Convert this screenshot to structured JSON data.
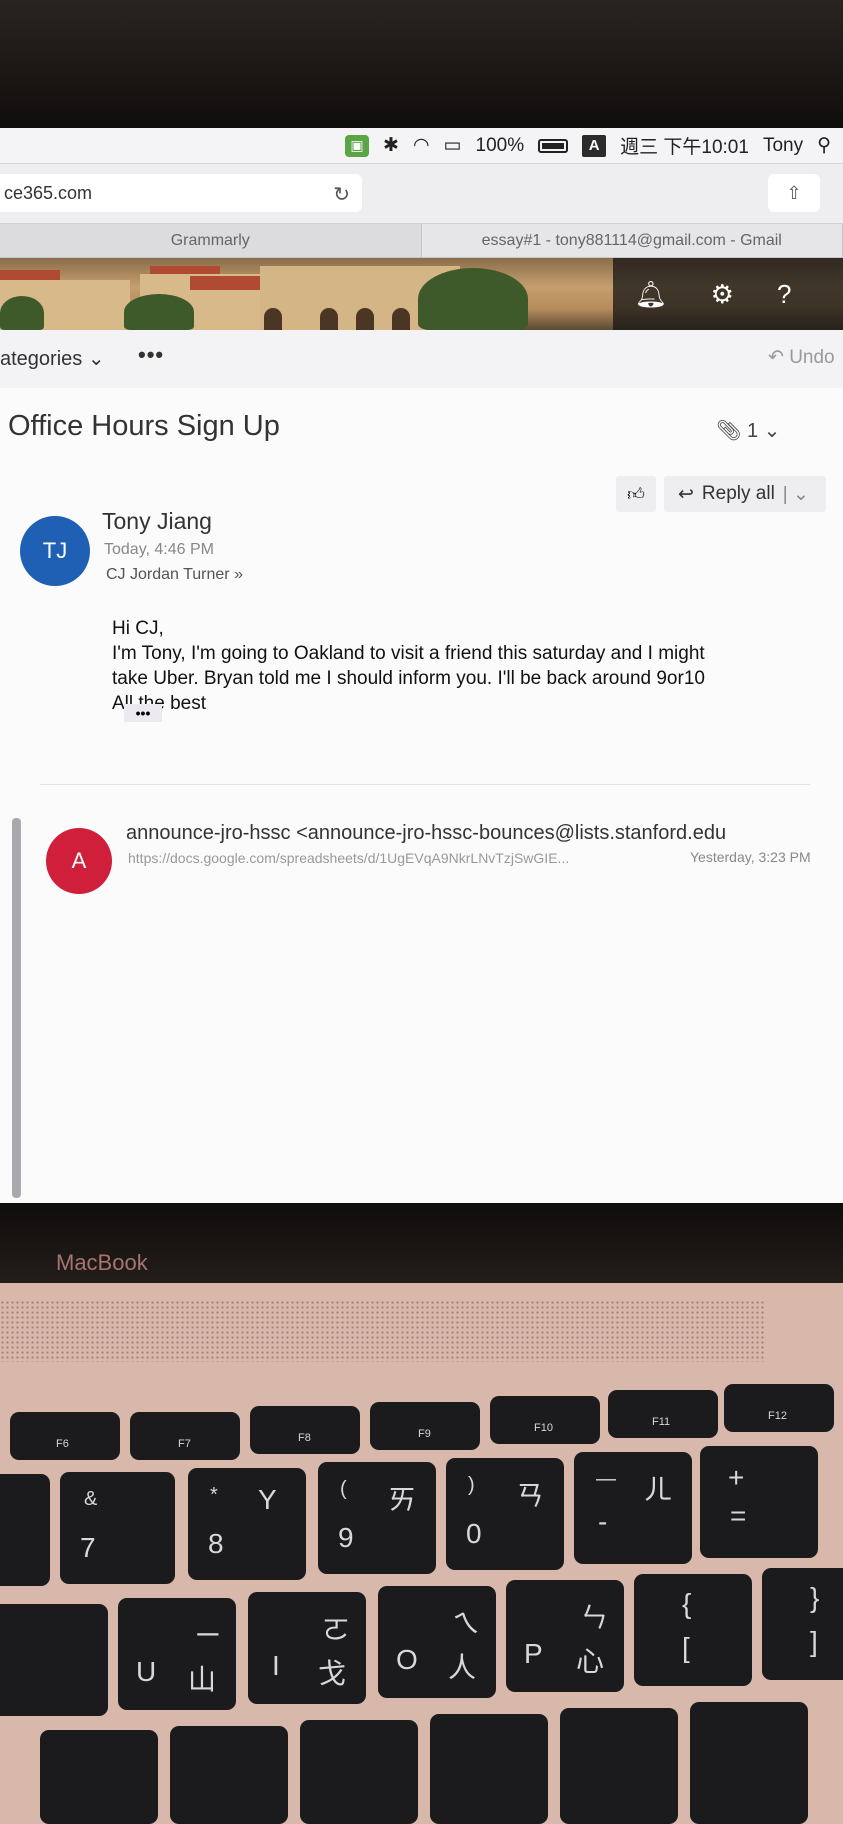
{
  "menubar": {
    "battery": "100%",
    "input_indicator": "A",
    "clock": "週三 下午10:01",
    "user": "Tony"
  },
  "safari": {
    "url": "ce365.com",
    "tabs": [
      "Grammarly",
      "essay#1 - tony881114@gmail.com - Gmail"
    ]
  },
  "outlook": {
    "categories": "ategories",
    "more": "•••",
    "undo": "Undo",
    "subject": "Office Hours Sign Up",
    "attachment_count": "1",
    "message1": {
      "initials": "TJ",
      "sender": "Tony Jiang",
      "time": "Today, 4:46 PM",
      "to": "CJ Jordan Turner",
      "reply_label": "Reply all",
      "body": [
        "Hi CJ,",
        "I'm Tony, I'm going to Oakland to visit a friend this saturday and  I might",
        "take Uber. Bryan told me I should inform you. I'll be back around 9or10",
        "All the best"
      ],
      "more": "•••"
    },
    "message2": {
      "initials": "A",
      "sender": "announce-jro-hssc <announce-jro-hssc-bounces@lists.stanford.edu",
      "preview": "https://docs.google.com/spreadsheets/d/1UgEVqA9NkrLNvTzjSwGIE...",
      "time": "Yesterday, 3:23 PM"
    }
  },
  "laptop": {
    "brand": "MacBook",
    "fkeys": [
      "F6",
      "F7",
      "F8",
      "F9",
      "F10",
      "F11",
      "F12"
    ],
    "row1": [
      {
        "top": "&",
        "main": "7"
      },
      {
        "top": "*",
        "main": "8",
        "zh": "Y"
      },
      {
        "top": "(",
        "main": "9",
        "zh": "ㄞ"
      },
      {
        "top": ")",
        "main": "0",
        "zh": "ㄢ"
      },
      {
        "top": "—",
        "main": "-",
        "zh": "ㄦ"
      },
      {
        "top": "+",
        "main": "="
      }
    ],
    "row2": [
      {
        "main": "U",
        "zh": "ㄧ",
        "zh2": "山"
      },
      {
        "main": "I",
        "zh": "ㄛ",
        "zh2": "戈"
      },
      {
        "main": "O",
        "zh": "ㄟ",
        "zh2": "人"
      },
      {
        "main": "P",
        "zh": "ㄣ",
        "zh2": "心"
      },
      {
        "top": "{",
        "main": "["
      },
      {
        "top": "}",
        "main": "]"
      }
    ]
  }
}
